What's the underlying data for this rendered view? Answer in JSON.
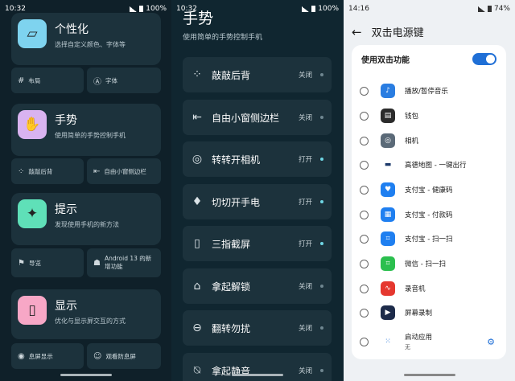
{
  "panel1": {
    "status": {
      "time": "10:32",
      "battery": "100%"
    },
    "cards": [
      {
        "title": "个性化",
        "desc": "选择自定义颜色、字体等",
        "icon": "personalize-icon",
        "color": "#7ed3ef",
        "subs": [
          {
            "label": "布局",
            "icon": "grid-icon"
          },
          {
            "label": "字体",
            "icon": "font-icon"
          }
        ]
      },
      {
        "title": "手势",
        "desc": "使用简单的手势控制手机",
        "icon": "hand-icon",
        "color": "#d9b3f0",
        "subs": [
          {
            "label": "敲敲后背",
            "icon": "tap-icon"
          },
          {
            "label": "自由小窗侧边栏",
            "icon": "sidebar-icon"
          }
        ]
      },
      {
        "title": "提示",
        "desc": "发现使用手机的新方法",
        "icon": "bulb-icon",
        "color": "#5fe0b8",
        "subs": [
          {
            "label": "导览",
            "icon": "flag-icon"
          },
          {
            "label": "Android 13 的新增功能",
            "icon": "android-icon"
          }
        ]
      },
      {
        "title": "显示",
        "desc": "优化与显示屏交互的方式",
        "icon": "display-icon",
        "color": "#f7a7c6",
        "subs": [
          {
            "label": "息屏显示",
            "icon": "eye-icon"
          },
          {
            "label": "观看防息屏",
            "icon": "person-icon"
          }
        ]
      }
    ]
  },
  "panel2": {
    "status": {
      "time": "10:32",
      "battery": "100%"
    },
    "title": "手势",
    "subtitle": "使用简单的手势控制手机",
    "items": [
      {
        "label": "敲敲后背",
        "state": "关闭",
        "icon": "tap-icon",
        "on": false
      },
      {
        "label": "自由小窗侧边栏",
        "state": "关闭",
        "icon": "sidebar-icon",
        "on": false
      },
      {
        "label": "转转开相机",
        "state": "打开",
        "icon": "camera-icon",
        "on": true
      },
      {
        "label": "切切开手电",
        "state": "打开",
        "icon": "flashlight-icon",
        "on": true
      },
      {
        "label": "三指截屏",
        "state": "打开",
        "icon": "screenshot-icon",
        "on": true
      },
      {
        "label": "拿起解锁",
        "state": "关闭",
        "icon": "lock-icon",
        "on": false
      },
      {
        "label": "翻转勿扰",
        "state": "关闭",
        "icon": "dnd-icon",
        "on": false
      },
      {
        "label": "拿起静音",
        "state": "关闭",
        "icon": "mute-icon",
        "on": false
      }
    ]
  },
  "panel3": {
    "status": {
      "time": "14:16",
      "battery": "74%"
    },
    "title": "双击电源键",
    "toggle_label": "使用双击功能",
    "toggle_on": true,
    "options": [
      {
        "label": "播放/暂停音乐",
        "icon": "music-icon",
        "color": "#2a7de1"
      },
      {
        "label": "钱包",
        "icon": "wallet-icon",
        "color": "#2b2b2b"
      },
      {
        "label": "相机",
        "icon": "camera-icon",
        "color": "#5b6a78"
      },
      {
        "label": "高德地图 - 一键出行",
        "icon": "car-icon",
        "color": "#ffffff"
      },
      {
        "label": "支付宝 - 健康码",
        "icon": "alipay-health-icon",
        "color": "#1f7ff0"
      },
      {
        "label": "支付宝 - 付款码",
        "icon": "alipay-pay-icon",
        "color": "#1f7ff0"
      },
      {
        "label": "支付宝 - 扫一扫",
        "icon": "alipay-scan-icon",
        "color": "#1f7ff0"
      },
      {
        "label": "微信 - 扫一扫",
        "icon": "wechat-scan-icon",
        "color": "#2bbf4e"
      },
      {
        "label": "录音机",
        "icon": "recorder-icon",
        "color": "#e5382f"
      },
      {
        "label": "屏幕录制",
        "icon": "screen-record-icon",
        "color": "#1d2b4a"
      },
      {
        "label": "启动应用",
        "desc": "无",
        "icon": "apps-icon",
        "color": "#ffffff"
      }
    ]
  }
}
